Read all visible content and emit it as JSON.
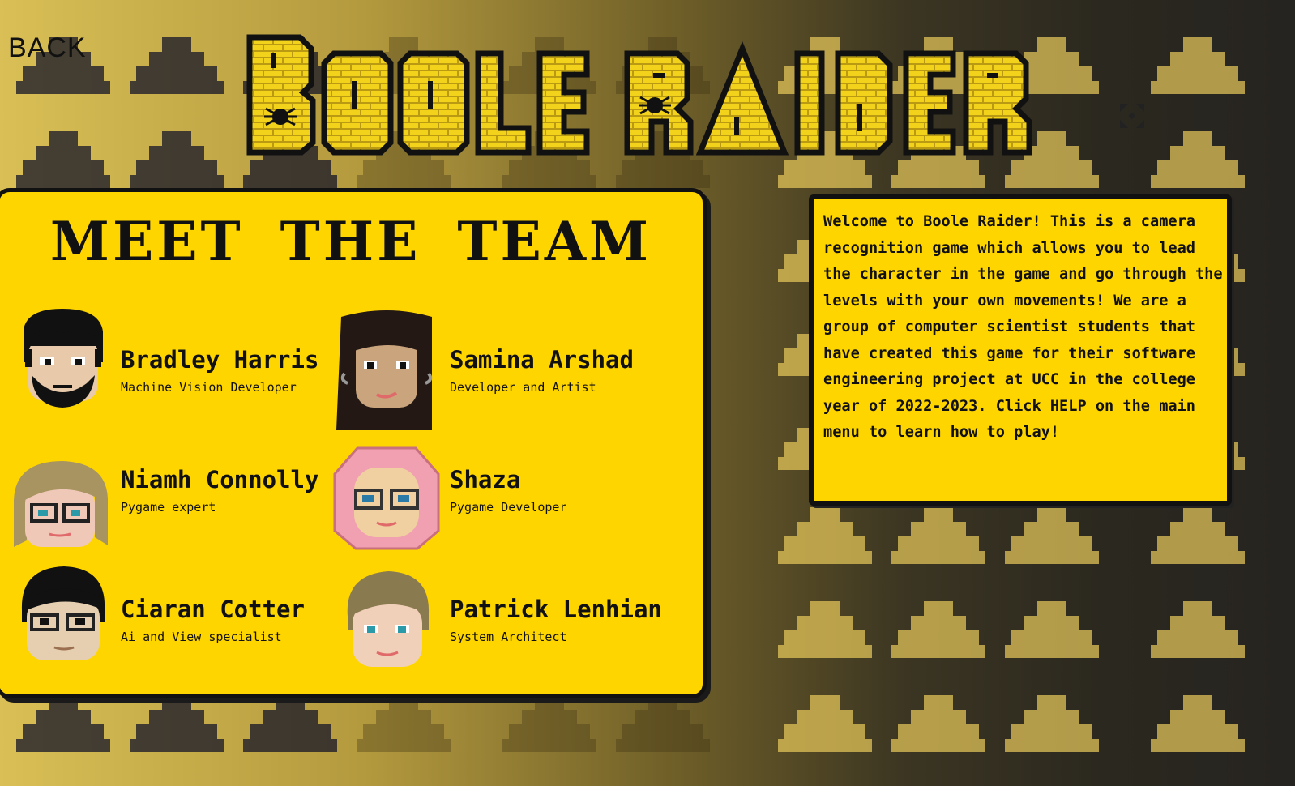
{
  "back_label": "BACK",
  "logo": {
    "text": "BOOLE RAIDER"
  },
  "team": {
    "title": "MEET THE TEAM",
    "members": [
      {
        "name": "Bradley Harris",
        "role": "Machine Vision Developer"
      },
      {
        "name": "Samina Arshad",
        "role": "Developer and Artist"
      },
      {
        "name": "Niamh Connolly",
        "role": "Pygame expert"
      },
      {
        "name": "Shaza",
        "role": "Pygame Developer"
      },
      {
        "name": "Ciaran Cotter",
        "role": "Ai and View specialist"
      },
      {
        "name": "Patrick Lenhian",
        "role": "System Architect"
      }
    ]
  },
  "info": {
    "text": "Welcome to Boole Raider! This is a camera recognition game which allows you to lead the character in the game and go through the levels with your own movements! We are a group of computer scientist students that have created this game for their software engineering project at UCC in the college year of 2022-2023. Click HELP on the main menu to learn how to play!"
  },
  "icons": {
    "cursor": "crosshair-cursor-icon"
  },
  "colors": {
    "panel": "#ffd500",
    "border": "#111111",
    "brick": "#f2d21a"
  }
}
